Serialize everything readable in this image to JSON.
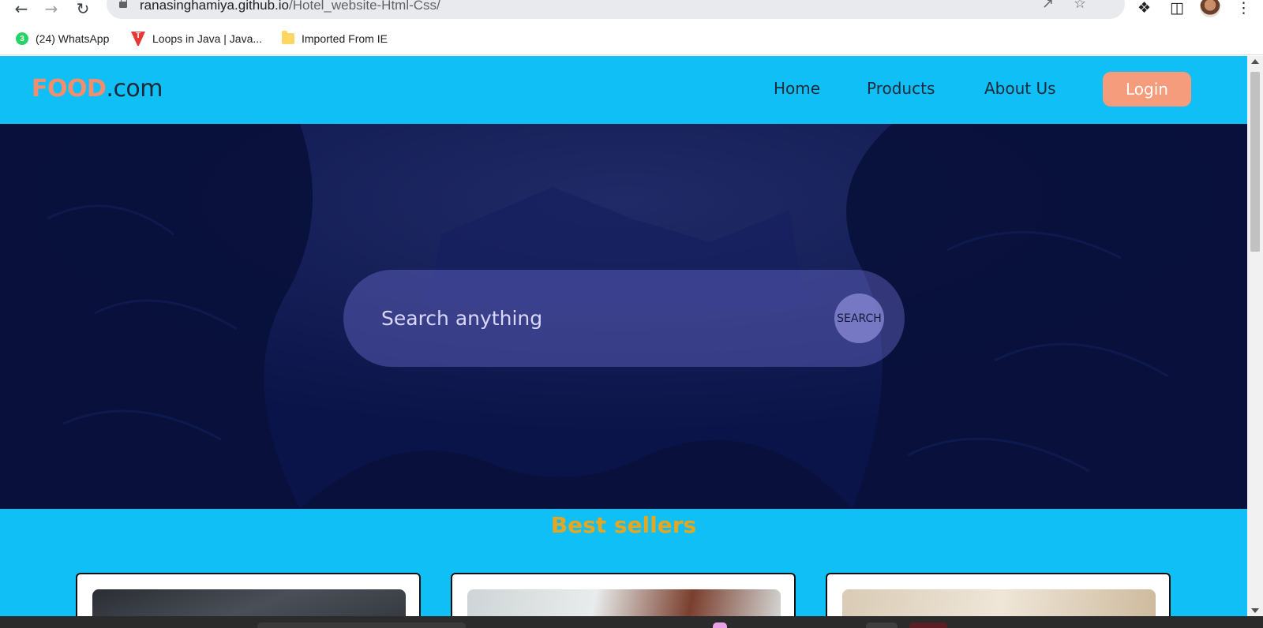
{
  "browser": {
    "url_host": "ranasinghamiya.github.io",
    "url_path": "/Hotel_website-Html-Css/",
    "bookmarks": [
      {
        "label": "(24) WhatsApp",
        "badge": "3",
        "icon": "whatsapp-icon"
      },
      {
        "label": "Loops in Java | Java...",
        "badge": "T",
        "icon": "tutorial-site-icon"
      },
      {
        "label": "Imported From IE",
        "icon": "folder-icon"
      }
    ]
  },
  "site": {
    "logo": {
      "brand": "FOOD",
      "suffix": ".com"
    },
    "nav": {
      "home": "Home",
      "products": "Products",
      "about": "About Us",
      "login": "Login"
    },
    "search": {
      "placeholder": "Search anything",
      "button": "SEARCH"
    },
    "best_sellers_title": "Best sellers"
  },
  "colors": {
    "site_background": "#0fbff5",
    "logo_accent": "#f28d6e",
    "login_button": "#f59c7d",
    "hero_overlay": "#0b1448",
    "section_title": "#e6a720"
  }
}
